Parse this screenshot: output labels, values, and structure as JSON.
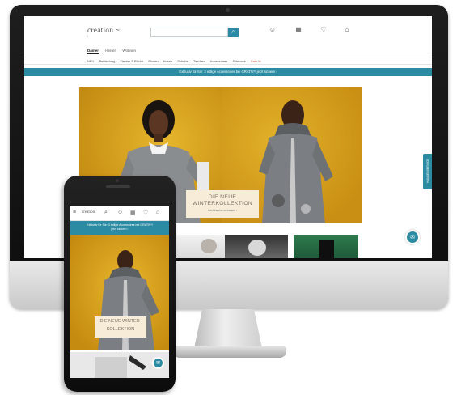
{
  "brand": {
    "logo_text": "creation",
    "logo_mark": "~",
    "tagline": "l"
  },
  "header": {
    "search_placeholder": "",
    "search_icon": "search-icon",
    "icons": [
      {
        "name": "account-icon",
        "glyph": "☺",
        "label": ""
      },
      {
        "name": "catalog-icon",
        "glyph": "▦",
        "label": ""
      },
      {
        "name": "wishlist-icon",
        "glyph": "♡",
        "label": ""
      },
      {
        "name": "cart-icon",
        "glyph": "⌂",
        "label": ""
      }
    ]
  },
  "tabs": [
    "Damen",
    "Herren",
    "Wohnen"
  ],
  "categories": [
    "NEU",
    "Bekleidung",
    "Kleider & Röcke",
    "Blusen",
    "Hosen",
    "Schuhe",
    "Taschen",
    "Accessoires",
    "Schmuck",
    "Sale %"
  ],
  "promo": {
    "desktop": "Exklusiv für Sie: 3 edlige Accessoires bei GRATIS*! jetzt sichern ›",
    "mobile_line1": "Exklusiv für Sie: 3 edlige Accessoires bei GRATIS*!",
    "mobile_line2": "jetzt sichern ›"
  },
  "hero": {
    "headline_line1": "DIE NEUE",
    "headline_line2": "WINTERKOLLEKTION",
    "cta": "Jetzt inspirieren lassen ›"
  },
  "side_tab_label": "KUNDENSERVICE",
  "chat": {
    "glyph": "✉"
  },
  "mobile": {
    "menu_icon": "≡",
    "menu_label": "",
    "headline_line1": "DIE NEUE WINTER-",
    "headline_line2": "KOLLEKTION"
  },
  "colors": {
    "accent": "#2b8ba3",
    "hero_bg": "#d6a21f",
    "card_bg": "#f7ecd8"
  }
}
